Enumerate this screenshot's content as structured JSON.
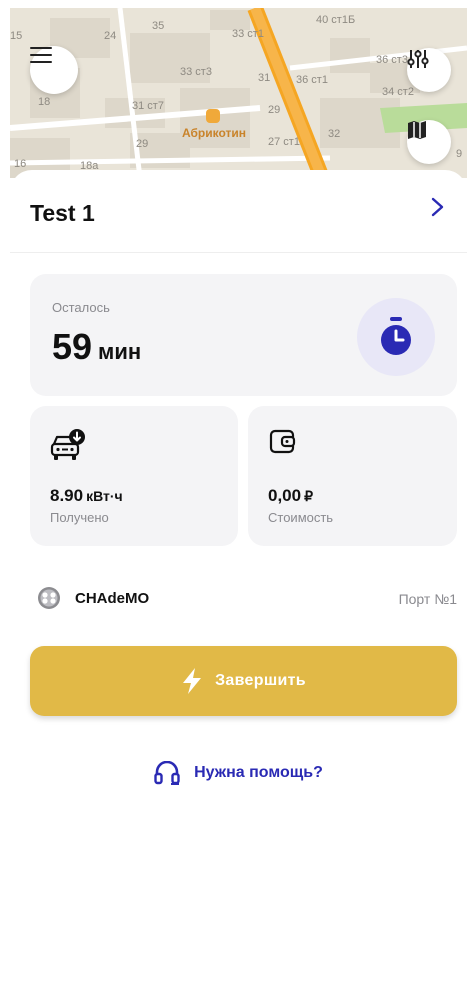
{
  "map": {
    "labels": [
      "15",
      "24",
      "35",
      "33 ст1",
      "40 ст1Б",
      "33 ст3",
      "31",
      "36 ст1",
      "36 ст3",
      "34 ст2",
      "18",
      "31 ст7",
      "29",
      "29",
      "27 ст1",
      "32",
      "16",
      "18а",
      "9"
    ],
    "poi_label": "Абрикотин",
    "icons": {
      "menu": "hamburger-menu-icon",
      "filter": "filter-sliders-icon",
      "map_layers": "map-icon"
    }
  },
  "station": {
    "title": "Test 1"
  },
  "remaining": {
    "label": "Осталось",
    "value": "59",
    "unit": "мин"
  },
  "energy": {
    "value": "8.90",
    "unit": "кВт·ч",
    "label": "Получено"
  },
  "cost": {
    "value": "0,00",
    "unit": "₽",
    "label": "Стоимость"
  },
  "connector": {
    "name": "CHAdeMO",
    "port": "Порт №1"
  },
  "actions": {
    "finish_label": "Завершить",
    "help_label": "Нужна помощь?"
  },
  "colors": {
    "accent_yellow": "#e1b947",
    "accent_blue": "#2a2ab4",
    "timer_bg": "#e8e7f7",
    "road": "#f5a623"
  }
}
